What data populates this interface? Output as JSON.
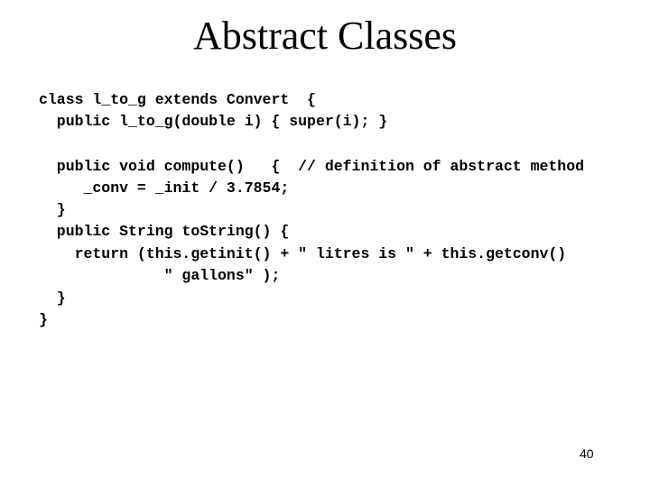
{
  "slide": {
    "title": "Abstract Classes",
    "code_lines": [
      "class l_to_g extends Convert  {",
      "  public l_to_g(double i) { super(i); }",
      "",
      "  public void compute()   {  // definition of abstract method",
      "     _conv = _init / 3.7854;",
      "  }",
      "  public String toString() {",
      "    return (this.getinit() + \" litres is \" + this.getconv()",
      "              \" gallons\" );",
      "  }",
      "}"
    ],
    "page_number": "40"
  }
}
